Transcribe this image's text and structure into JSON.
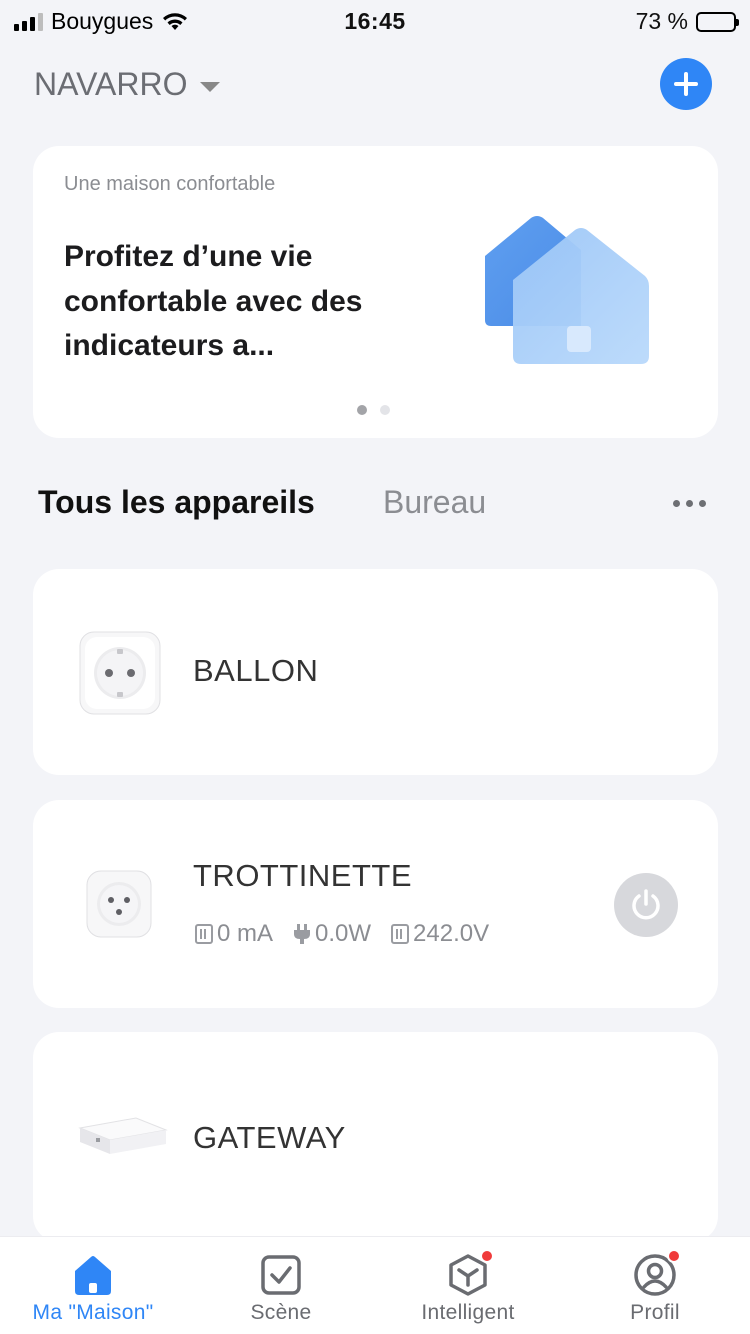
{
  "status_bar": {
    "carrier": "Bouygues",
    "time": "16:45",
    "battery_percent": "73 %",
    "battery_level": 0.73
  },
  "home": {
    "name": "NAVARRO"
  },
  "banner": {
    "subtitle": "Une maison confortable",
    "headline": "Profitez d’une vie confortable avec des indicateurs a...",
    "page_index": 0,
    "page_count": 2
  },
  "tabs": {
    "all": "Tous les appareils",
    "room": "Bureau"
  },
  "devices": [
    {
      "name": "BALLON",
      "icon": "smart-plug-icon"
    },
    {
      "name": "TROTTINETTE",
      "icon": "smart-plug-icon",
      "current": "0 mA",
      "power": "0.0W",
      "voltage": "242.0V",
      "switch_state": "off"
    },
    {
      "name": "GATEWAY",
      "icon": "gateway-hub-icon"
    }
  ],
  "nav": {
    "home": "Ma \"Maison\"",
    "scene": "Scène",
    "smart": "Intelligent",
    "profile": "Profil"
  },
  "colors": {
    "accent": "#2f86f6",
    "badge": "#f03b3b",
    "background": "#f3f4f8"
  }
}
